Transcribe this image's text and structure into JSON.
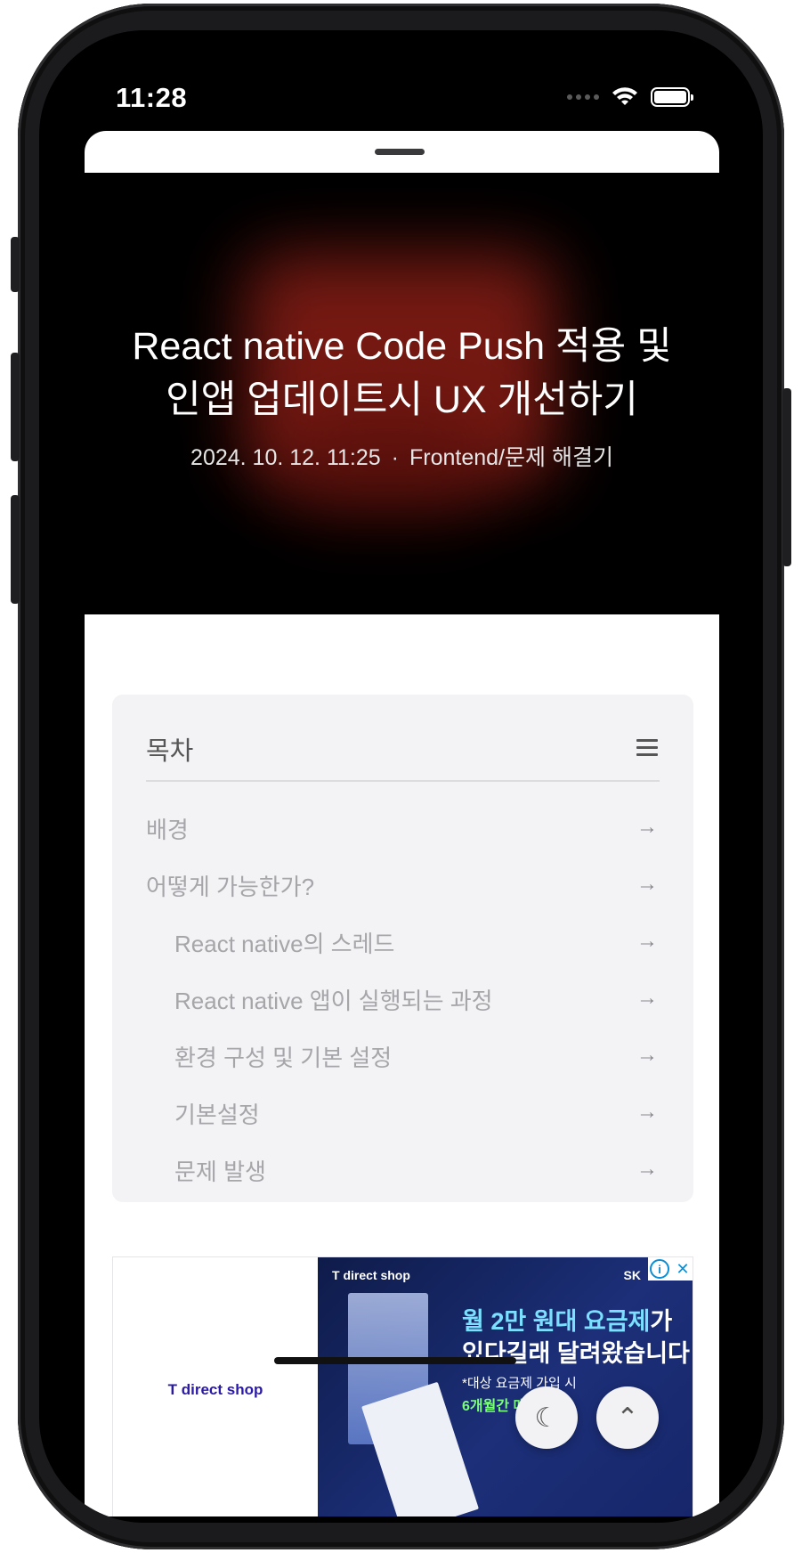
{
  "status_bar": {
    "time": "11:28"
  },
  "hero": {
    "title_line1": "React native Code Push 적용 및",
    "title_line2": "인앱 업데이트시 UX 개선하기",
    "date": "2024. 10. 12. 11:25",
    "separator": "·",
    "category": "Frontend/문제 해결기"
  },
  "toc": {
    "title": "목차",
    "items": [
      {
        "label": "배경",
        "level": 1
      },
      {
        "label": "어떻게 가능한가?",
        "level": 1
      },
      {
        "label": "React native의 스레드",
        "level": 2
      },
      {
        "label": "React native 앱이 실행되는 과정",
        "level": 2
      },
      {
        "label": "환경 구성 및 기본 설정",
        "level": 2
      },
      {
        "label": "기본설정",
        "level": 2
      },
      {
        "label": "문제 발생",
        "level": 2
      }
    ],
    "arrow": "→"
  },
  "ad": {
    "left_logo": "T direct shop",
    "banner_logo": "T direct shop",
    "banner_brand": "SK",
    "headline_highlight": "월 2만 원대 요금제",
    "headline_rest": "가",
    "headline_line2": "있다길래 달려왔습니다",
    "fineprint": "*대상 요금제 가입 시",
    "offer": "6개월간 매달",
    "info_icon": "i",
    "close_icon": "✕"
  },
  "fabs": {
    "moon_icon": "☾",
    "up_icon": "⌃"
  },
  "colors": {
    "accent_ad": "#2a1aa8",
    "hero_glow": "#8a1e16"
  }
}
